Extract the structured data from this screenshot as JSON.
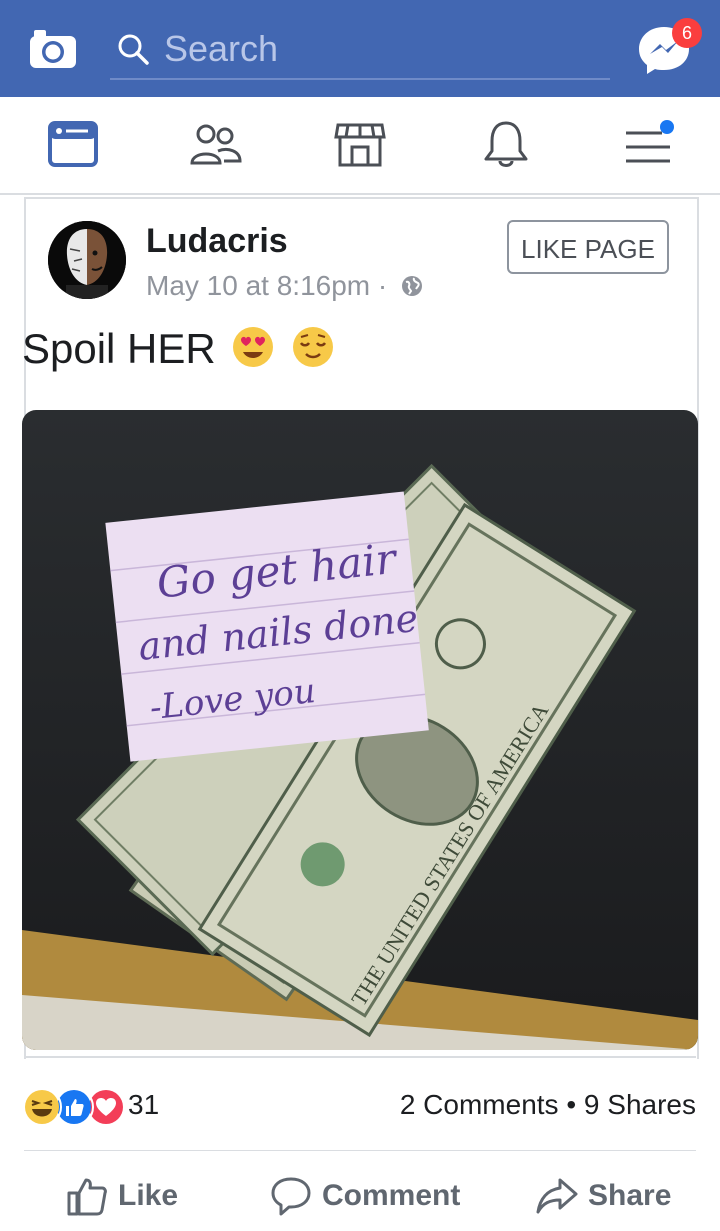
{
  "topbar": {
    "search_placeholder": "Search",
    "messenger_badge": "6",
    "brand_color": "#4267b2"
  },
  "nav": {
    "items": [
      {
        "icon": "news-feed-icon",
        "active": true
      },
      {
        "icon": "friends-icon",
        "active": false
      },
      {
        "icon": "marketplace-icon",
        "active": false
      },
      {
        "icon": "notifications-icon",
        "active": false
      },
      {
        "icon": "menu-icon",
        "active": false,
        "dot": true
      }
    ]
  },
  "post": {
    "author": "Ludacris",
    "timestamp": "May 10 at 8:16pm",
    "separator": "·",
    "like_page_label": "LIKE PAGE",
    "text": "Spoil HER",
    "note_lines": [
      "Go get hair",
      "and nails done",
      "-Love you"
    ],
    "reaction_count": "31",
    "comments": "2 Comments",
    "shares": "9 Shares",
    "stats_separator": " • "
  },
  "actions": {
    "like": "Like",
    "comment": "Comment",
    "share": "Share"
  }
}
